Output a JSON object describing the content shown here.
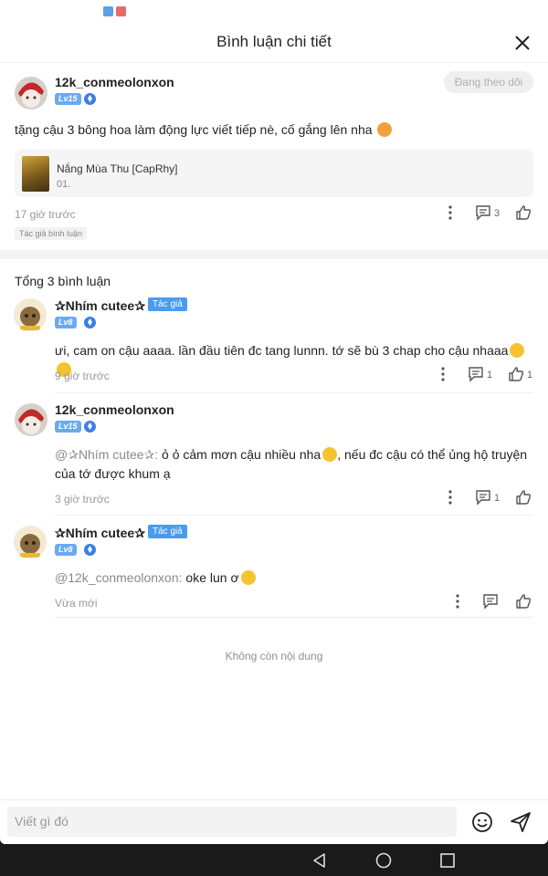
{
  "header": {
    "title": "Bình luận chi tiết"
  },
  "main_comment": {
    "username": "12k_conmeolonxon",
    "level": "Lv15",
    "follow_label": "Đang theo dõi",
    "text": "tặng cậu 3 bông hoa làm động lực viết tiếp nè, cố gắng lên nha",
    "book_title": "Nắng Mùa Thu [CapRhy]",
    "chapter": "01.",
    "time": "17 giờ trước",
    "reply_count": "3",
    "tag": "Tác giả bình luận"
  },
  "replies_header": {
    "total_label": "Tổng 3 bình luận"
  },
  "replies": [
    {
      "username": "✰Nhím cutee✰",
      "author_tag": "Tác giả",
      "level": "Lv8",
      "mention": "",
      "text": "ưi, cam on cậu aaaa. lần đầu tiên đc tang lunnn. tớ sẽ bù 3 chap cho cậu nhaaa",
      "time": "9 giờ trước",
      "reply_count": "1",
      "like_count": "1"
    },
    {
      "username": "12k_conmeolonxon",
      "author_tag": "",
      "level": "Lv15",
      "mention": "@✰Nhím cutee✰:",
      "text": "ỏ ỏ cảm mơn cậu nhiều nha",
      "text2": ", nếu đc cậu có thể ủng hộ truyện của tớ được khum ạ",
      "time": "3 giờ trước",
      "reply_count": "1",
      "like_count": ""
    },
    {
      "username": "✰Nhím cutee✰",
      "author_tag": "Tác giả",
      "level": "Lv8",
      "mention": "@12k_conmeolonxon:",
      "text": "oke lun ơ",
      "time": "Vừa mới",
      "reply_count": "",
      "like_count": ""
    }
  ],
  "end_label": "Không còn nội dung",
  "input": {
    "placeholder": "Viết gì đó"
  },
  "colors": {
    "accent": "#4a9bf0",
    "level_badge": "#6aaaf0",
    "muted": "#999999"
  }
}
